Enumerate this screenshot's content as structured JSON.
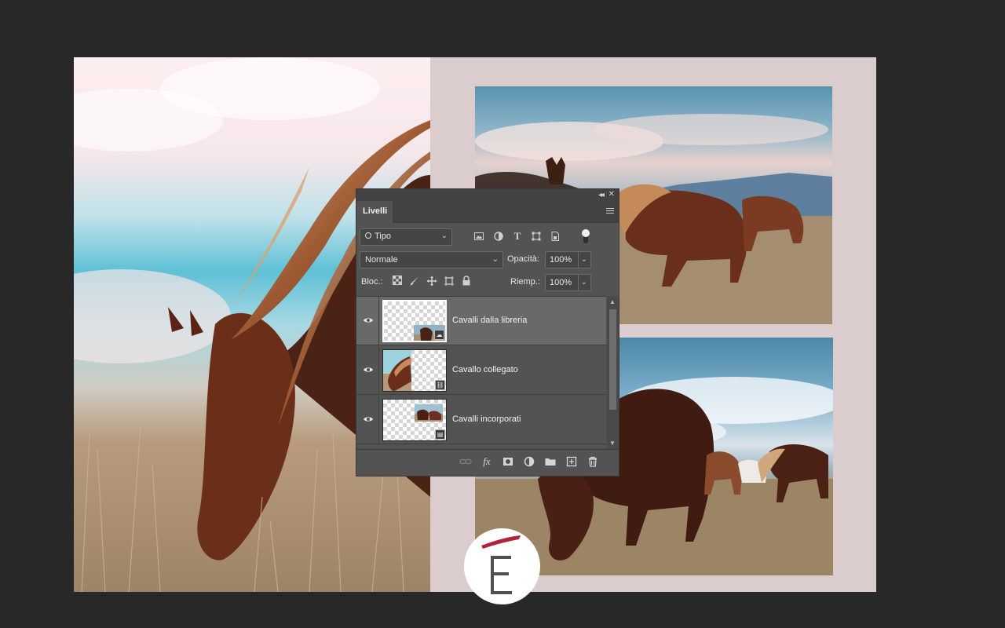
{
  "panel": {
    "tab_label": "Livelli",
    "filter_kind_label": "Tipo",
    "blend_mode": "Normale",
    "opacity_label": "Opacità:",
    "opacity_value": "100%",
    "lock_label": "Bloc.:",
    "fill_label": "Riemp.:",
    "fill_value": "100%",
    "filter_icons": [
      "image-filter-icon",
      "adjustment-filter-icon",
      "type-filter-icon",
      "shape-filter-icon",
      "smart-object-filter-icon"
    ],
    "lock_icons": [
      "lock-transparent-pixels-icon",
      "lock-image-pixels-icon",
      "lock-position-icon",
      "lock-artboard-icon",
      "lock-all-icon"
    ],
    "layers": [
      {
        "name": "Cavalli dalla libreria",
        "selected": true,
        "badge_icon": "cloud-library-icon"
      },
      {
        "name": "Cavallo collegato",
        "selected": false,
        "badge_icon": "linked-file-icon"
      },
      {
        "name": "Cavalli incorporati",
        "selected": false,
        "badge_icon": "smart-object-icon"
      }
    ],
    "bottom_icons": [
      "link-layers-icon",
      "fx-icon",
      "add-mask-icon",
      "adjustment-layer-icon",
      "new-group-icon",
      "new-layer-icon",
      "trash-icon"
    ]
  },
  "logo": {
    "letter": "E",
    "accent_color": "#b2233a"
  },
  "colors": {
    "workspace_bg": "#282828",
    "document_bg": "#dbcccd",
    "panel_bg": "#535353",
    "selected_row": "#696969"
  }
}
